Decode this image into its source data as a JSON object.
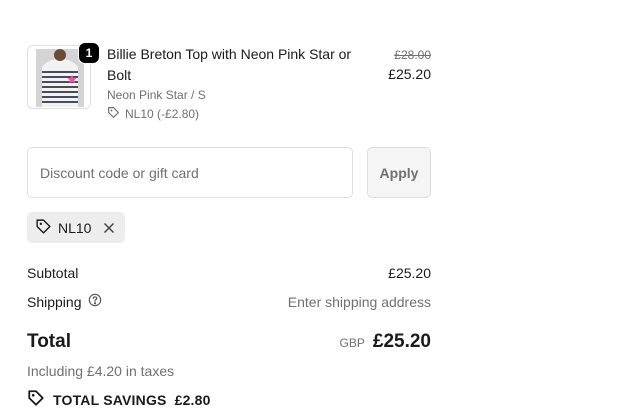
{
  "cart_item": {
    "quantity": "1",
    "name": "Billie Breton Top with Neon Pink Star or Bolt",
    "variant": "Neon Pink Star / S",
    "discount": "NL10 (-£2.80)",
    "original_price": "£28.00",
    "price": "£25.20",
    "image_icon": "striped-top-thumbnail"
  },
  "discount_form": {
    "placeholder": "Discount code or gift card",
    "value": "",
    "apply_label": "Apply"
  },
  "applied_code": {
    "code": "NL10"
  },
  "summary": {
    "subtotal_label": "Subtotal",
    "subtotal_value": "£25.20",
    "shipping_label": "Shipping",
    "shipping_value": "Enter shipping address",
    "total_label": "Total",
    "currency": "GBP",
    "total_value": "£25.20",
    "taxes_note": "Including £4.20 in taxes",
    "savings_label": "TOTAL SAVINGS",
    "savings_value": "£2.80"
  }
}
